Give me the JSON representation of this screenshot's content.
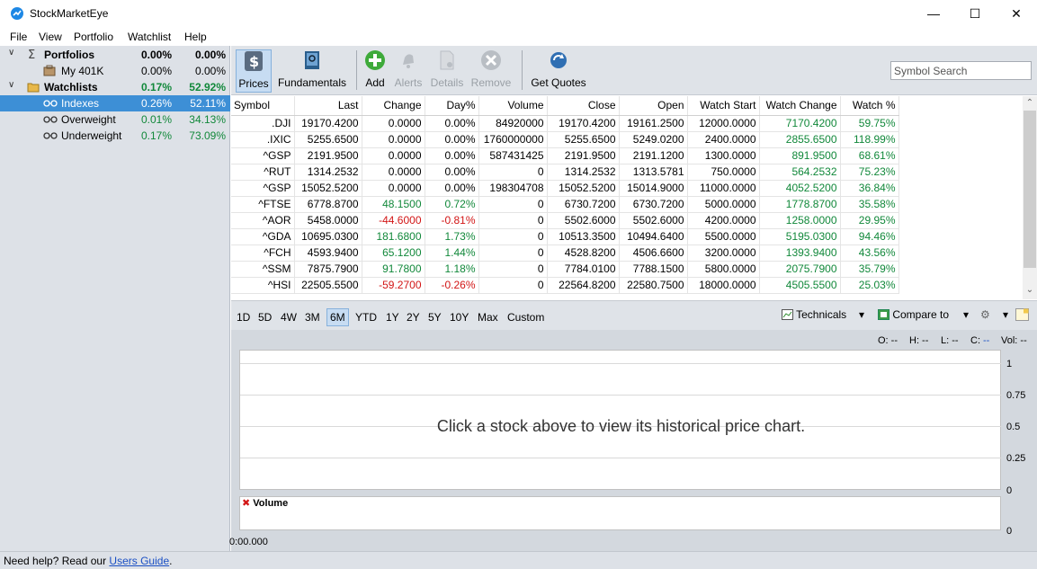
{
  "window": {
    "title": "StockMarketEye",
    "minimize": "—",
    "maximize": "☐",
    "close": "✕"
  },
  "menu": [
    "File",
    "View",
    "Portfolio",
    "Watchlist",
    "Help"
  ],
  "tree": {
    "portfolios": {
      "label": "Portfolios",
      "day": "0.00%",
      "total": "0.00%"
    },
    "my401k": {
      "label": "My 401K",
      "day": "0.00%",
      "total": "0.00%"
    },
    "watchlists": {
      "label": "Watchlists",
      "day": "0.17%",
      "total": "52.92%"
    },
    "indexes": {
      "label": "Indexes",
      "day": "0.26%",
      "total": "52.11%"
    },
    "overweight": {
      "label": "Overweight",
      "day": "0.01%",
      "total": "34.13%"
    },
    "underweight": {
      "label": "Underweight",
      "day": "0.17%",
      "total": "73.09%"
    }
  },
  "toolbar": {
    "prices": "Prices",
    "fundamentals": "Fundamentals",
    "add": "Add",
    "alerts": "Alerts",
    "details": "Details",
    "remove": "Remove",
    "get_quotes": "Get Quotes",
    "search_placeholder": "Symbol Search"
  },
  "grid": {
    "headers": [
      "Symbol",
      "Last",
      "Change",
      "Day%",
      "Volume",
      "Close",
      "Open",
      "Watch Start",
      "Watch Change",
      "Watch %"
    ],
    "rows": [
      [
        ".DJI",
        "19170.4200",
        "0.0000",
        "0.00%",
        "84920000",
        "19170.4200",
        "19161.2500",
        "12000.0000",
        "7170.4200",
        "59.75%"
      ],
      [
        ".IXIC",
        "5255.6500",
        "0.0000",
        "0.00%",
        "1760000000",
        "5255.6500",
        "5249.0200",
        "2400.0000",
        "2855.6500",
        "118.99%"
      ],
      [
        "^GSP",
        "2191.9500",
        "0.0000",
        "0.00%",
        "587431425",
        "2191.9500",
        "2191.1200",
        "1300.0000",
        "891.9500",
        "68.61%"
      ],
      [
        "^RUT",
        "1314.2532",
        "0.0000",
        "0.00%",
        "0",
        "1314.2532",
        "1313.5781",
        "750.0000",
        "564.2532",
        "75.23%"
      ],
      [
        "^GSP",
        "15052.5200",
        "0.0000",
        "0.00%",
        "198304708",
        "15052.5200",
        "15014.9000",
        "11000.0000",
        "4052.5200",
        "36.84%"
      ],
      [
        "^FTSE",
        "6778.8700",
        "48.1500",
        "0.72%",
        "0",
        "6730.7200",
        "6730.7200",
        "5000.0000",
        "1778.8700",
        "35.58%"
      ],
      [
        "^AOR",
        "5458.0000",
        "-44.6000",
        "-0.81%",
        "0",
        "5502.6000",
        "5502.6000",
        "4200.0000",
        "1258.0000",
        "29.95%"
      ],
      [
        "^GDA",
        "10695.0300",
        "181.6800",
        "1.73%",
        "0",
        "10513.3500",
        "10494.6400",
        "5500.0000",
        "5195.0300",
        "94.46%"
      ],
      [
        "^FCH",
        "4593.9400",
        "65.1200",
        "1.44%",
        "0",
        "4528.8200",
        "4506.6600",
        "3200.0000",
        "1393.9400",
        "43.56%"
      ],
      [
        "^SSM",
        "7875.7900",
        "91.7800",
        "1.18%",
        "0",
        "7784.0100",
        "7788.1500",
        "5800.0000",
        "2075.7900",
        "35.79%"
      ],
      [
        "^HSI",
        "22505.5500",
        "-59.2700",
        "-0.26%",
        "0",
        "22564.8200",
        "22580.7500",
        "18000.0000",
        "4505.5500",
        "25.03%"
      ]
    ]
  },
  "ranges": [
    "1D",
    "5D",
    "4W",
    "3M",
    "6M",
    "YTD",
    "1Y",
    "2Y",
    "5Y",
    "10Y",
    "Max",
    "Custom"
  ],
  "chart_tools": {
    "technicals": "Technicals",
    "compare": "Compare to"
  },
  "ohlc": {
    "o": "O: --",
    "h": "H: --",
    "l": "L: --",
    "c_label": "C:",
    "c_value": "--",
    "vol": "Vol: --"
  },
  "chart": {
    "message": "Click a stock above to view its historical price chart.",
    "y_ticks": [
      "1",
      "0.75",
      "0.5",
      "0.25"
    ],
    "vol_ticks": [
      "0",
      "0"
    ],
    "volume_label": "Volume",
    "time_label": "0:00.000"
  },
  "status": {
    "prefix": "Need help? Read our ",
    "link": "Users Guide",
    "suffix": "."
  },
  "colors": {
    "green": "#11883a",
    "red": "#d21515",
    "selection": "#3d8fd6"
  }
}
